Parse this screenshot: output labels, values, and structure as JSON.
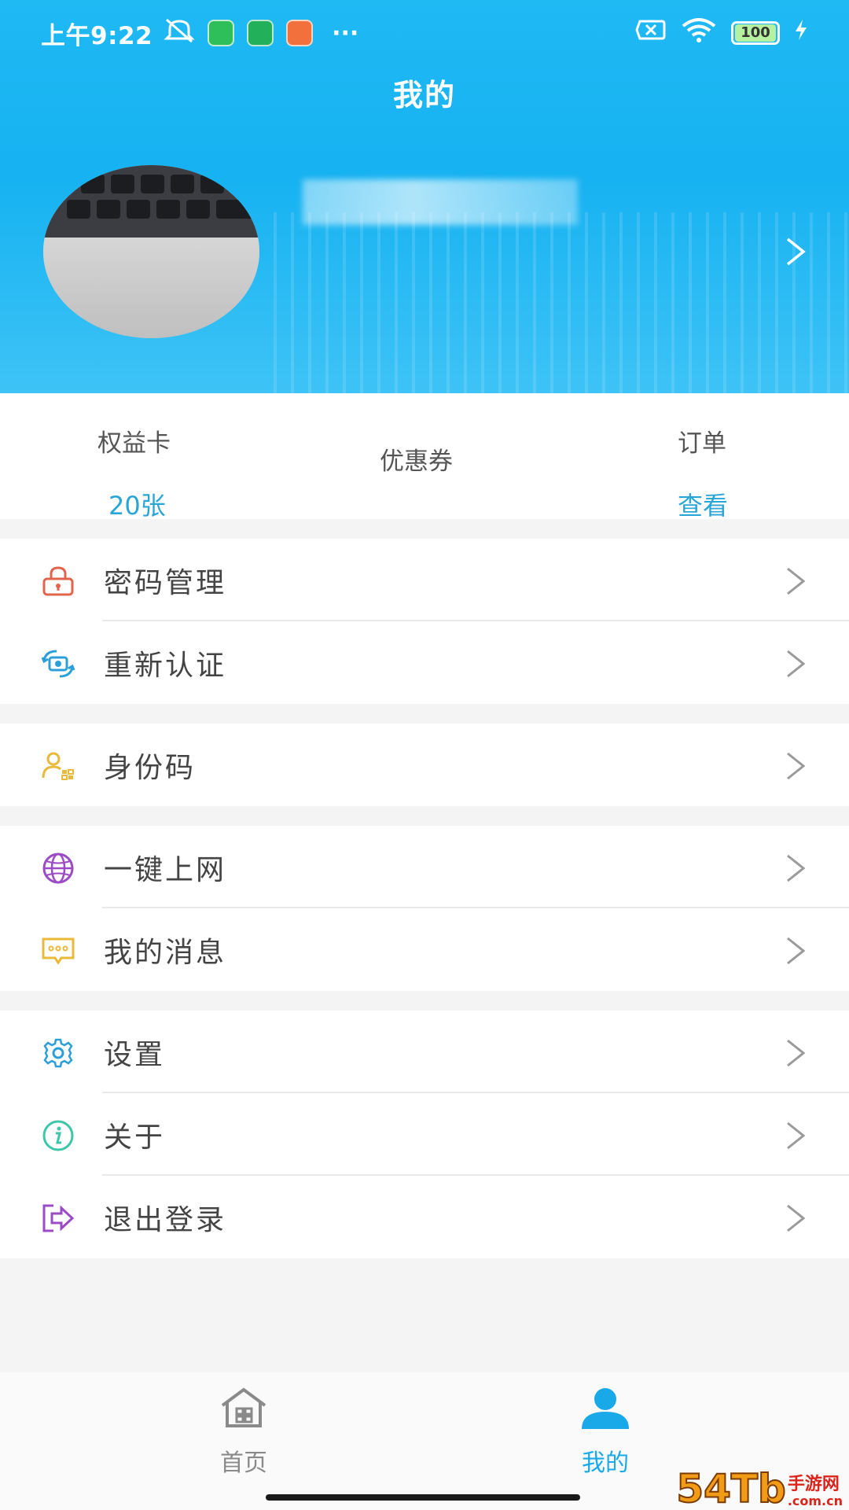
{
  "status_bar": {
    "time": "上午9:22",
    "more": "···",
    "battery": "100",
    "icons": [
      "mute-alarm-icon",
      "app-badge-green",
      "app-badge-shield",
      "app-badge-orange",
      "sim-off-icon",
      "wifi-icon",
      "battery-icon",
      "charging-icon"
    ]
  },
  "header": {
    "title": "我的",
    "avatar_icon": "avatar-photo",
    "arrow_icon": "chevron-right-icon"
  },
  "stats": {
    "benefit_card_label": "权益卡",
    "benefit_card_value": "20张",
    "coupon_label": "优惠券",
    "order_label": "订单",
    "order_value": "查看"
  },
  "menu_groups": [
    {
      "items": [
        {
          "label": "密码管理",
          "icon": "lock-icon"
        },
        {
          "label": "重新认证",
          "icon": "reauth-camera-icon"
        }
      ]
    },
    {
      "items": [
        {
          "label": "身份码",
          "icon": "id-code-icon"
        }
      ]
    },
    {
      "items": [
        {
          "label": "一键上网",
          "icon": "globe-icon"
        },
        {
          "label": "我的消息",
          "icon": "message-icon"
        }
      ]
    },
    {
      "items": [
        {
          "label": "设置",
          "icon": "gear-icon"
        },
        {
          "label": "关于",
          "icon": "info-icon"
        },
        {
          "label": "退出登录",
          "icon": "logout-icon"
        }
      ]
    }
  ],
  "tabbar": {
    "home_label": "首页",
    "mine_label": "我的"
  },
  "colors": {
    "header_blue": "#1fb9f4",
    "accent_text": "#2aa6d6",
    "tab_active": "#1aa9e8",
    "tab_inactive": "#8a8a8a"
  },
  "watermark": {
    "big": "54Tb",
    "small_top": "手游网",
    "small_bottom": ".com.cn"
  }
}
